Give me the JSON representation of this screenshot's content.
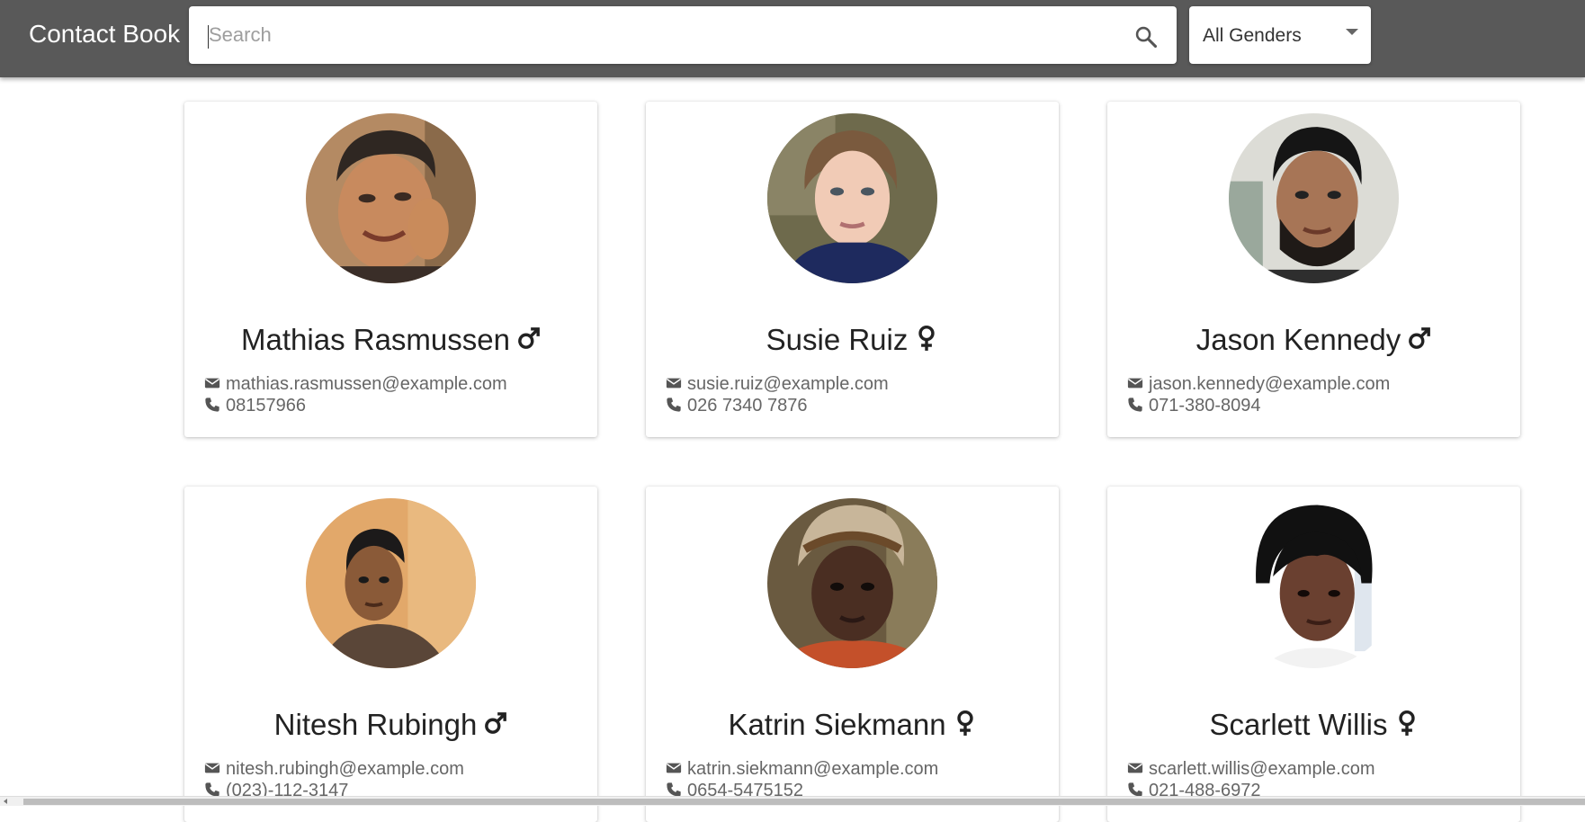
{
  "app": {
    "title": "Contact Book"
  },
  "search": {
    "placeholder": "Search",
    "value": ""
  },
  "filter": {
    "selected": "All Genders"
  },
  "colors": {
    "appbar": "#595959",
    "text": "#222222",
    "muted": "#666666"
  },
  "contacts": [
    {
      "name": "Mathias Rasmussen",
      "gender_icon": "male-icon",
      "email": "mathias.rasmussen@example.com",
      "phone": "08157966"
    },
    {
      "name": "Susie Ruiz",
      "gender_icon": "female-icon",
      "email": "susie.ruiz@example.com",
      "phone": "026 7340 7876"
    },
    {
      "name": "Jason Kennedy",
      "gender_icon": "male-icon",
      "email": "jason.kennedy@example.com",
      "phone": "071-380-8094"
    },
    {
      "name": "Nitesh Rubingh",
      "gender_icon": "male-icon",
      "email": "nitesh.rubingh@example.com",
      "phone": "(023)-112-3147"
    },
    {
      "name": "Katrin Siekmann",
      "gender_icon": "female-icon",
      "email": "katrin.siekmann@example.com",
      "phone": "0654-5475152"
    },
    {
      "name": "Scarlett Willis",
      "gender_icon": "female-icon",
      "email": "scarlett.willis@example.com",
      "phone": "021-488-6972"
    }
  ]
}
